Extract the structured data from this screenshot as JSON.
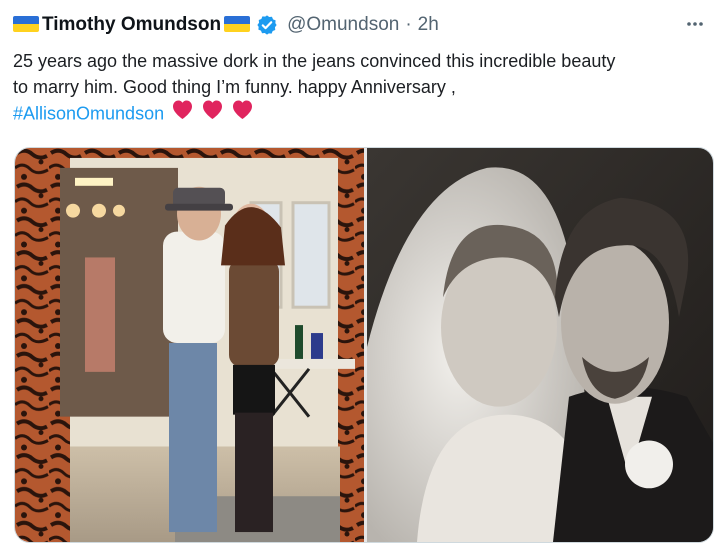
{
  "tweet": {
    "display_name": "Timothy Omundson",
    "handle": "@Omundson",
    "separator": "·",
    "timestamp": "2h",
    "text_line_1": "25 years ago the massive dork in the jeans convinced this incredible beauty",
    "text_line_2": "to marry him. Good thing I’m funny.  happy Anniversary ,",
    "hashtag": "#AllisonOmundson",
    "colors": {
      "text": "#0f1419",
      "secondary": "#536471",
      "link": "#1d9bf0",
      "verified": "#1d9bf0",
      "heart": "#e0245e",
      "flag_blue": "#2a6fd6",
      "flag_yellow": "#ffd21f"
    },
    "icons": [
      "ukraine-flag-icon",
      "verified-badge-icon",
      "more-options-icon",
      "red-heart-icon"
    ],
    "media": [
      {
        "name": "anniversary-photo-left"
      },
      {
        "name": "wedding-photo-right"
      }
    ]
  }
}
